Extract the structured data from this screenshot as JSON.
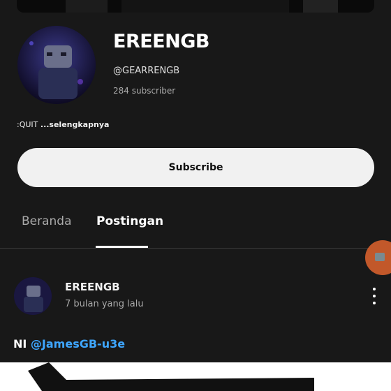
{
  "channel": {
    "name": "EREENGB",
    "handle": "@GEARRENGB",
    "subscribers": "284 subscriber",
    "description": ":QUIT",
    "more_label": "...selengkapnya",
    "subscribe_label": "Subscribe"
  },
  "tabs": [
    {
      "label": "Beranda",
      "active": false
    },
    {
      "label": "Postingan",
      "active": true
    }
  ],
  "post": {
    "author": "EREENGB",
    "time": "7 bulan yang lalu",
    "text_prefix": "NI",
    "mention": "@JamesGB-u3e"
  },
  "icons": {
    "avatar": "avatar",
    "more": "more-vert-icon",
    "camera": "camera-icon"
  },
  "colors": {
    "background": "#181818",
    "accent_mention": "#3ea6ff",
    "float_button": "#c2582a"
  }
}
